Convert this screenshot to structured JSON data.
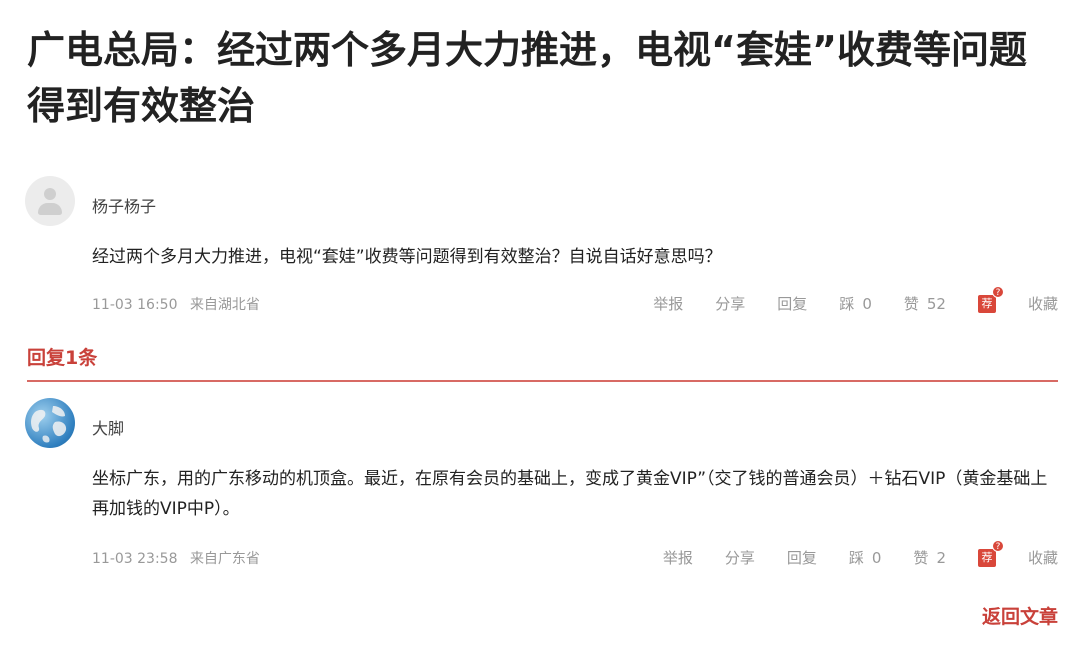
{
  "article": {
    "title": "广电总局：经过两个多月大力推进，电视“套娃”收费等问题得到有效整治"
  },
  "comments": [
    {
      "username": "杨子杨子",
      "avatar_icon": "default-avatar-icon",
      "content": "经过两个多月大力推进，电视“套娃”收费等问题得到有效整治？自说自话好意思吗？",
      "time": "11-03 16:50",
      "location": "来自湖北省",
      "actions": {
        "report": "举报",
        "share": "分享",
        "reply": "回复",
        "dislike": "踩",
        "dislike_count": "0",
        "like": "赞",
        "like_count": "52",
        "recommend": "荐",
        "recommend_badge": "?",
        "collect": "收藏"
      }
    },
    {
      "username": "大脚",
      "avatar_icon": "globe-avatar-icon",
      "content": "坐标广东，用的广东移动的机顶盒。最近，在原有会员的基础上，变成了黄金VIP”（交了钱的普通会员）＋钻石VIP（黄金基础上再加钱的VIP中P）。",
      "time": "11-03 23:58",
      "location": "来自广东省",
      "actions": {
        "report": "举报",
        "share": "分享",
        "reply": "回复",
        "dislike": "踩",
        "dislike_count": "0",
        "like": "赞",
        "like_count": "2",
        "recommend": "荐",
        "recommend_badge": "?",
        "collect": "收藏"
      }
    }
  ],
  "replies": {
    "label": "回复1条"
  },
  "footer": {
    "back_label": "返回文章"
  },
  "colors": {
    "accent": "#c9413a",
    "divider": "#d86a64",
    "muted": "#999999"
  }
}
